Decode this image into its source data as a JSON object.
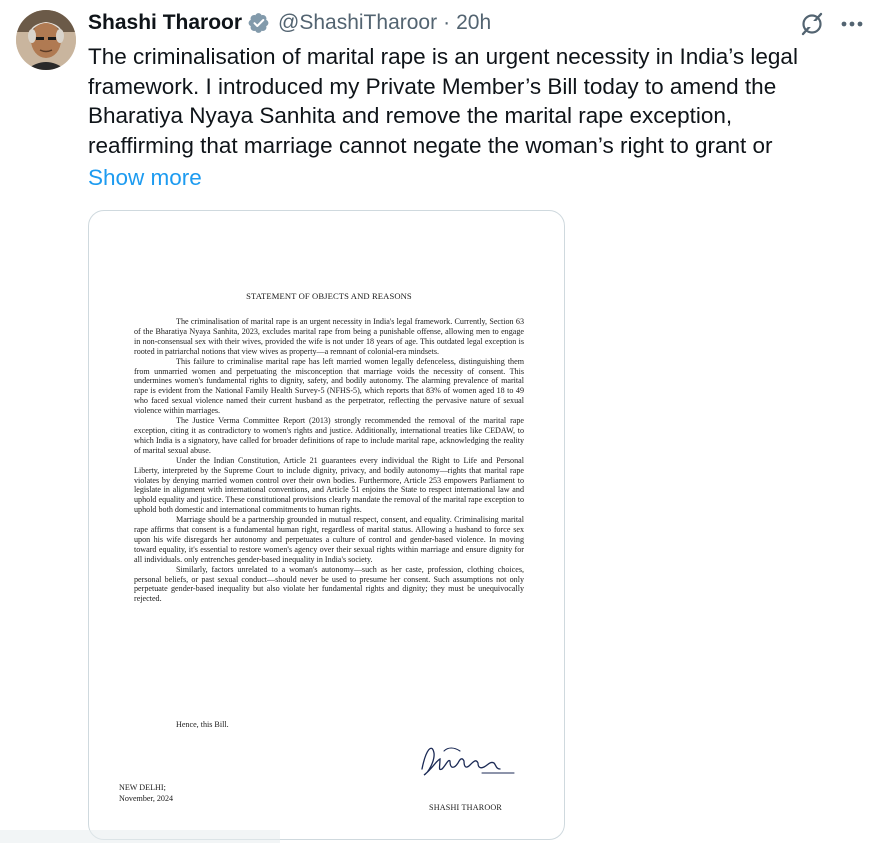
{
  "author": {
    "display_name": "Shashi Tharoor",
    "handle": "@ShashiTharoor",
    "separator": "·",
    "timestamp": "20h",
    "verified": true,
    "verified_color": "#1d9bf0"
  },
  "actions": {
    "grok_icon": "grok-icon",
    "more_icon": "more-horizontal-icon"
  },
  "tweet": {
    "lines": [
      "The criminalisation of marital rape is an urgent necessity in India’s legal",
      "framework. I introduced my Private Member’s Bill today to amend the",
      "Bharatiya Nyaya Sanhita and remove the marital rape exception,",
      "reaffirming that marriage cannot negate the woman’s right to grant or"
    ],
    "show_more": "Show more",
    "link_color": "#1d9bf0"
  },
  "document": {
    "title": "STATEMENT OF OBJECTS AND REASONS",
    "paragraphs": [
      "The criminalisation of marital rape is an urgent necessity in India's legal framework. Currently, Section 63 of the Bharatiya Nyaya Sanhita, 2023, excludes marital rape from being a punishable offense, allowing men to engage in non-consensual sex with their wives, provided the wife is not under 18 years of age. This outdated legal exception is rooted in patriarchal notions that view wives as property—a remnant of colonial-era mindsets.",
      "This failure to criminalise marital rape has left married women legally defenceless, distinguishing them from unmarried women and perpetuating the misconception that marriage voids the necessity of consent. This undermines women's fundamental rights to dignity, safety, and bodily autonomy. The alarming prevalence of marital rape is evident from the National Family Health Survey-5 (NFHS-5), which reports that 83% of women aged 18 to 49 who faced sexual violence named their current husband as the perpetrator, reflecting the pervasive nature of sexual violence within marriages.",
      "The Justice Verma Committee Report (2013) strongly recommended the removal of the marital rape exception, citing it as contradictory to women's rights and justice. Additionally, international treaties like CEDAW, to which India is a signatory, have called for broader definitions of rape to include marital rape, acknowledging the reality of marital sexual abuse.",
      "Under the Indian Constitution, Article 21 guarantees every individual the Right to Life and Personal Liberty, interpreted by the Supreme Court to include dignity, privacy, and bodily autonomy—rights that marital rape violates by denying married women control over their own bodies. Furthermore, Article 253 empowers Parliament to legislate in alignment with international conventions, and Article 51 enjoins the State to respect international law and uphold equality and justice. These constitutional provisions clearly mandate the removal of the marital rape exception to uphold both domestic and international commitments to human rights.",
      "Marriage should be a partnership grounded in mutual respect, consent, and equality. Criminalising marital rape affirms that consent is a fundamental human right, regardless of marital status. Allowing a husband to force sex upon his wife disregards her autonomy and perpetuates a culture of control and gender-based violence. In moving toward equality, it's essential to restore women's agency over their sexual rights within marriage and ensure dignity for all individuals. only entrenches gender-based inequality in India's society.",
      "Similarly, factors unrelated to a woman's autonomy—such as her caste, profession, clothing choices, personal beliefs, or past sexual conduct—should never be used to presume her consent. Such assumptions not only perpetuate gender-based inequality but also violate her fundamental rights and dignity; they must be unequivocally rejected."
    ],
    "closing": "Hence, this Bill.",
    "place": "NEW DELHI;",
    "date": "November, 2024",
    "signer": "SHASHI THAROOR"
  }
}
